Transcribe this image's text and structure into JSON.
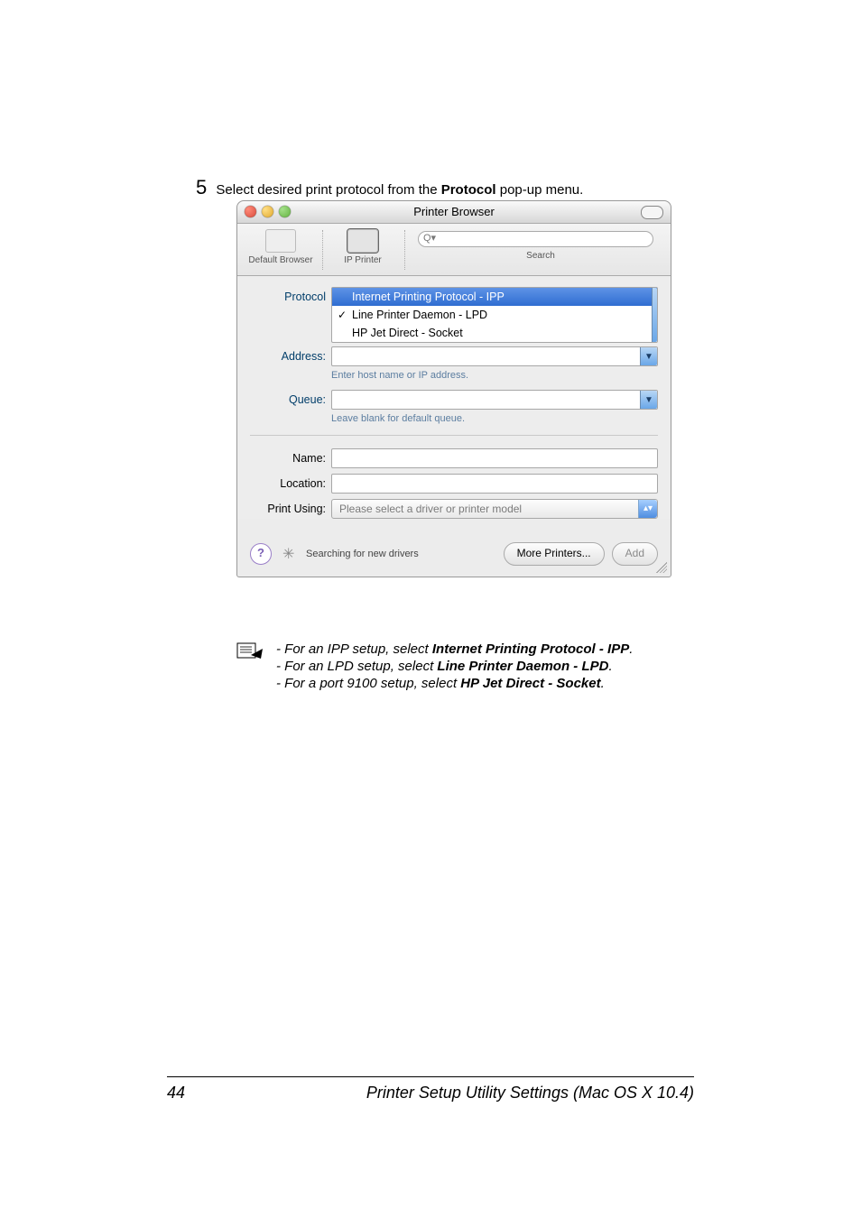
{
  "step": {
    "number": "5",
    "text_a": "Select desired print protocol from the ",
    "bold": "Protocol",
    "text_b": " pop-up menu."
  },
  "window": {
    "title": "Printer Browser",
    "toolbar": {
      "default_browser": "Default Browser",
      "ip_printer": "IP Printer",
      "search_label": "Search",
      "search_placeholder": "Q▾"
    },
    "labels": {
      "protocol": "Protocol",
      "address": "Address:",
      "queue": "Queue:",
      "name": "Name:",
      "location": "Location:",
      "print_using": "Print Using:"
    },
    "protocol_menu": {
      "items": [
        {
          "label": "Internet Printing Protocol - IPP",
          "highlight": true,
          "checked": false
        },
        {
          "label": "Line Printer Daemon - LPD",
          "highlight": false,
          "checked": true
        },
        {
          "label": "HP Jet Direct - Socket",
          "highlight": false,
          "checked": false
        }
      ]
    },
    "hints": {
      "address": "Enter host name or IP address.",
      "queue": "Leave blank for default queue."
    },
    "print_using_value": "Please select a driver or printer model",
    "footer": {
      "help": "?",
      "status": "Searching for new drivers",
      "more_printers": "More Printers...",
      "add": "Add"
    }
  },
  "note": {
    "l1a": "- For an IPP setup, select ",
    "l1b": "Internet Printing Protocol - IPP",
    "l1c": ".",
    "l2a": "- For an LPD setup, select ",
    "l2b": "Line Printer Daemon - LPD",
    "l2c": ".",
    "l3a": "- For a port 9100 setup, select ",
    "l3b": "HP Jet Direct - Socket",
    "l3c": "."
  },
  "page_footer": {
    "number": "44",
    "text": "Printer Setup Utility Settings (Mac OS X 10.4)"
  }
}
